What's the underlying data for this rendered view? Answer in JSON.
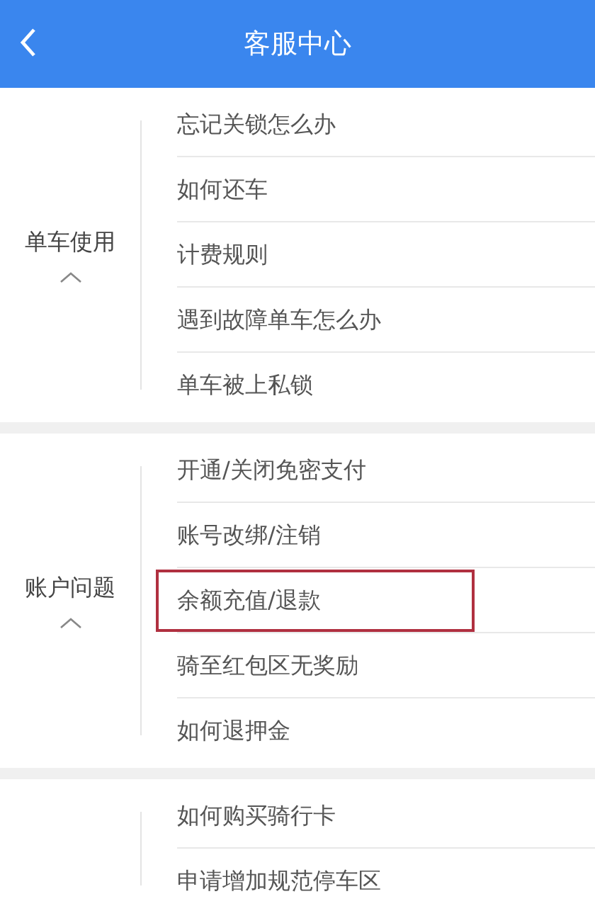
{
  "header": {
    "title": "客服中心"
  },
  "sections": [
    {
      "label": "单车使用",
      "expanded": true,
      "items": [
        {
          "text": "忘记关锁怎么办",
          "highlighted": false
        },
        {
          "text": "如何还车",
          "highlighted": false
        },
        {
          "text": "计费规则",
          "highlighted": false
        },
        {
          "text": "遇到故障单车怎么办",
          "highlighted": false
        },
        {
          "text": "单车被上私锁",
          "highlighted": false
        }
      ]
    },
    {
      "label": "账户问题",
      "expanded": true,
      "items": [
        {
          "text": "开通/关闭免密支付",
          "highlighted": false
        },
        {
          "text": "账号改绑/注销",
          "highlighted": false
        },
        {
          "text": "余额充值/退款",
          "highlighted": true
        },
        {
          "text": "骑至红包区无奖励",
          "highlighted": false
        },
        {
          "text": "如何退押金",
          "highlighted": false
        }
      ]
    },
    {
      "items": [
        {
          "text": "如何购买骑行卡",
          "highlighted": false
        },
        {
          "text": "申请增加规范停车区",
          "highlighted": false
        }
      ]
    }
  ]
}
